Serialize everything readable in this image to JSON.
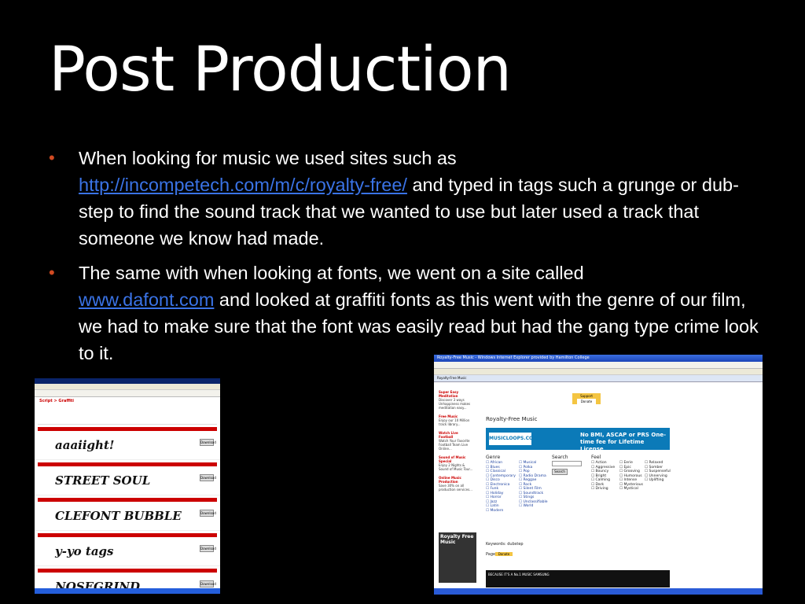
{
  "slide": {
    "title": "Post Production",
    "bullets": [
      {
        "before": "When looking for music we used sites such as ",
        "link": "http://incompetech.com/m/c/royalty-free/",
        "after": " and typed in tags such a grunge or dub-step to find the sound track that we wanted to use but later used a track that someone we know had made."
      },
      {
        "before": "The same with when looking at fonts, we went on a site called ",
        "link": "www.dafont.com",
        "after": " and looked at graffiti fonts as this went with the genre of our film, we had to make sure that the font was easily read but had the gang type crime look to it."
      }
    ]
  },
  "screenshot_dafont": {
    "heading": "Script > Graffiti",
    "fonts": [
      {
        "sample": "aaaiight!",
        "button": "Download"
      },
      {
        "sample": "STREET SOUL",
        "button": "Download"
      },
      {
        "sample": "CLEFONT BUBBLE",
        "button": "Download"
      },
      {
        "sample": "y-yo tags",
        "button": "Download"
      },
      {
        "sample": "NOSEGRIND",
        "button": "Download"
      }
    ]
  },
  "screenshot_music": {
    "window_title": "Royalty-Free Music - Windows Internet Explorer provided by Hamilton College",
    "tab_label": "Royalty-Free Music",
    "page_heading": "Royalty-Free Music",
    "banner_logo": "MUSICLOOPS.COM",
    "banner_text": "No BMI, ASCAP or PRS One-time fee for Lifetime License",
    "support_label": "Support",
    "donate_label": "Donate",
    "sidebar": [
      {
        "heading": "Super Easy Meditation",
        "text": "Discover 3 ways Unhappiness makes meditation easy..."
      },
      {
        "heading": "Free Music",
        "text": "Enjoy our 10 Million track library..."
      },
      {
        "heading": "Watch Live Football",
        "text": "Watch Your Favorite Football Team Live Online..."
      },
      {
        "heading": "Sound of Music Special",
        "text": "Enjoy 2 Nights & Sound of Music Tour..."
      },
      {
        "heading": "Online Music Production",
        "text": "Save 30% on all production services..."
      }
    ],
    "genre_heading": "Genre",
    "genres": [
      "African",
      "Blues",
      "Classical",
      "Contemporary",
      "Disco",
      "Electronica",
      "Funk",
      "Holiday",
      "Horror",
      "Jazz",
      "Latin",
      "Modern"
    ],
    "genres2": [
      "Musical",
      "Polka",
      "Pop",
      "Radio Drama",
      "Reggae",
      "Rock",
      "Silent Film",
      "Soundtrack",
      "Stings",
      "Unclassifiable",
      "World"
    ],
    "search_heading": "Search",
    "search_button": "Search",
    "feel_heading": "Feel",
    "feels": [
      "Action",
      "Aggressive",
      "Bouncy",
      "Bright",
      "Calming",
      "Dark",
      "Driving"
    ],
    "feels2": [
      "Eerie",
      "Epic",
      "Grooving",
      "Humorous",
      "Intense",
      "Mysterious",
      "Mystical"
    ],
    "feels3": [
      "Relaxed",
      "Somber",
      "Suspenseful",
      "Unnerving",
      "Uplifting"
    ],
    "feel_search_button": "Search",
    "box_label": "Royalty Free Music",
    "keywords_label": "Keywords: dubstep",
    "page_label": "Page:",
    "bottom_banner": "BECAUSE IT'S A No.1 MUSIC SAMSUNG"
  }
}
